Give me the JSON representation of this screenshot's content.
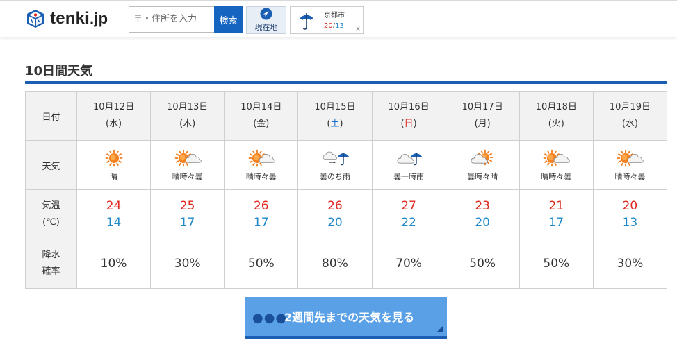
{
  "header": {
    "logo_text": "tenki",
    "logo_suffix": ".jp",
    "search_placeholder": "〒・住所を入力",
    "search_button": "検索",
    "locate_label": "現在地",
    "recent": {
      "city": "京都市",
      "high": "20",
      "sep": "/",
      "low": "13",
      "close": "x",
      "icon": "umbrella-icon"
    }
  },
  "section_title": "10日間天気",
  "table": {
    "row_labels": {
      "date": "日付",
      "weather": "天気",
      "temp_line1": "気温",
      "temp_line2": "(℃)",
      "rain_line1": "降水",
      "rain_line2": "確率"
    },
    "days": [
      {
        "date": "10月12日",
        "dow": "(水)",
        "dow_type": "weekday",
        "weather": "晴",
        "icon": "sun",
        "high": "24",
        "low": "14",
        "rain": "10%"
      },
      {
        "date": "10月13日",
        "dow": "(木)",
        "dow_type": "weekday",
        "weather": "晴時々曇",
        "icon": "sun-cloud",
        "high": "25",
        "low": "17",
        "rain": "30%"
      },
      {
        "date": "10月14日",
        "dow": "(金)",
        "dow_type": "weekday",
        "weather": "晴時々曇",
        "icon": "sun-cloud",
        "high": "26",
        "low": "17",
        "rain": "50%"
      },
      {
        "date": "10月15日",
        "dow": "(土)",
        "dow_type": "sat",
        "weather": "曇のち雨",
        "icon": "cloud-then-rain",
        "high": "26",
        "low": "20",
        "rain": "80%"
      },
      {
        "date": "10月16日",
        "dow": "(日)",
        "dow_type": "sun",
        "weather": "曇一時雨",
        "icon": "cloud-rain",
        "high": "27",
        "low": "22",
        "rain": "70%"
      },
      {
        "date": "10月17日",
        "dow": "(月)",
        "dow_type": "weekday",
        "weather": "曇時々晴",
        "icon": "cloud-sun",
        "high": "23",
        "low": "20",
        "rain": "50%"
      },
      {
        "date": "10月18日",
        "dow": "(火)",
        "dow_type": "weekday",
        "weather": "晴時々曇",
        "icon": "sun-cloud",
        "high": "21",
        "low": "17",
        "rain": "50%"
      },
      {
        "date": "10月19日",
        "dow": "(水)",
        "dow_type": "weekday",
        "weather": "晴時々曇",
        "icon": "sun-cloud",
        "high": "20",
        "low": "13",
        "rain": "30%"
      }
    ]
  },
  "cta": {
    "dots": "●●●",
    "label": "2週間先までの天気を見る"
  },
  "colors": {
    "brand_blue": "#1a5fb4",
    "search_button": "#1565c0",
    "cta_bg": "#5aa0e6",
    "temp_high": "#e0281e",
    "temp_low": "#1e88c8",
    "saturday": "#1a70c8",
    "sunday": "#e0281e"
  }
}
